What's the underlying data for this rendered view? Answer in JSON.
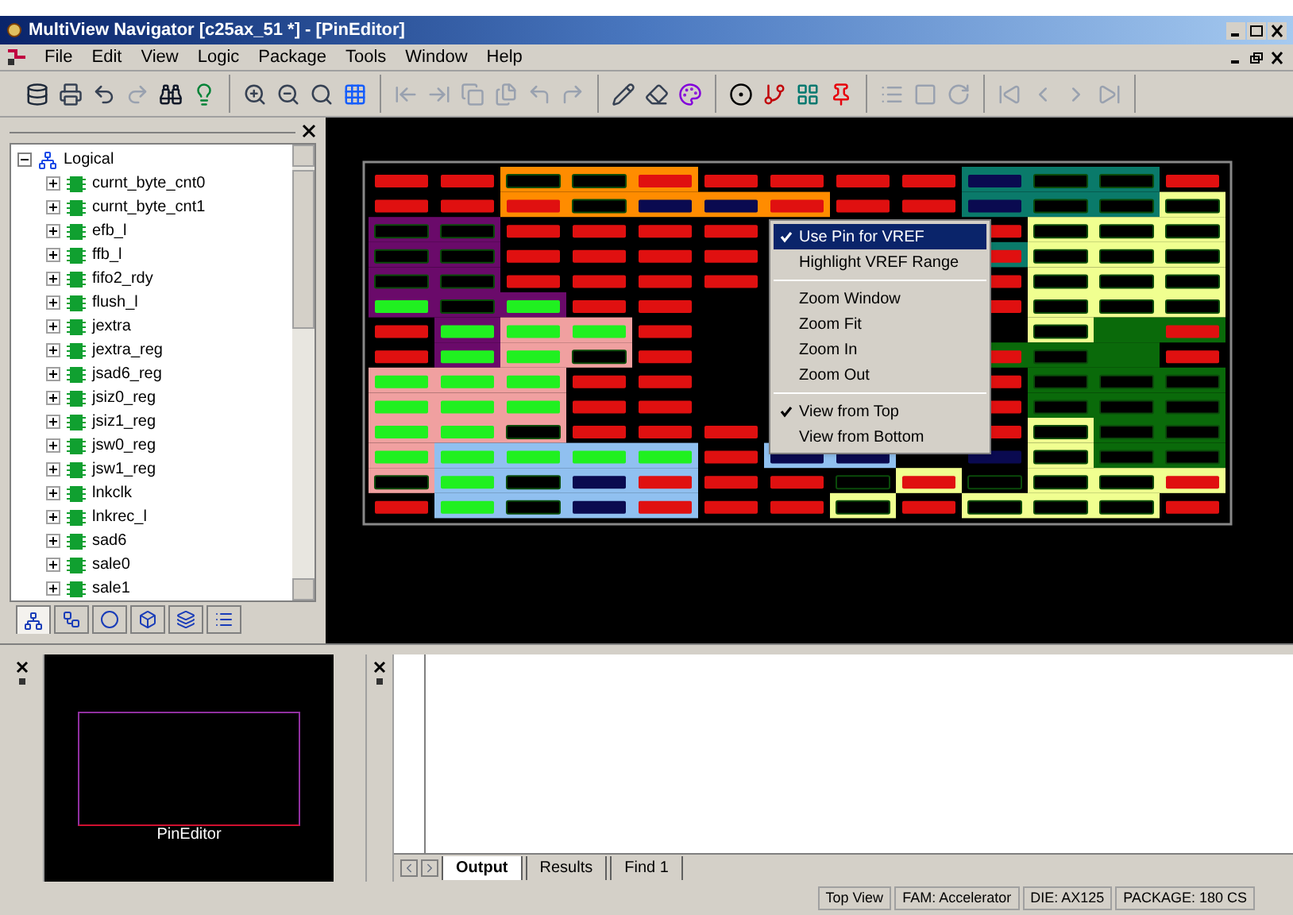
{
  "window": {
    "title": "MultiView Navigator [c25ax_51 *] - [PinEditor]"
  },
  "menu": [
    "File",
    "Edit",
    "View",
    "Logic",
    "Package",
    "Tools",
    "Window",
    "Help"
  ],
  "tree": {
    "label": "Logical",
    "expanded": true,
    "children": [
      {
        "label": "curnt_byte_cnt0",
        "expanded": false
      },
      {
        "label": "curnt_byte_cnt1",
        "expanded": false
      },
      {
        "label": "efb_l",
        "expanded": false
      },
      {
        "label": "ffb_l",
        "expanded": false
      },
      {
        "label": "fifo2_rdy",
        "expanded": false
      },
      {
        "label": "flush_l",
        "expanded": false
      },
      {
        "label": "jextra",
        "expanded": false
      },
      {
        "label": "jextra_reg",
        "expanded": false
      },
      {
        "label": "jsad6_reg",
        "expanded": false
      },
      {
        "label": "jsiz0_reg",
        "expanded": false
      },
      {
        "label": "jsiz1_reg",
        "expanded": false
      },
      {
        "label": "jsw0_reg",
        "expanded": false
      },
      {
        "label": "jsw1_reg",
        "expanded": false
      },
      {
        "label": "lnkclk",
        "expanded": false
      },
      {
        "label": "lnkrec_l",
        "expanded": false
      },
      {
        "label": "sad6",
        "expanded": false
      },
      {
        "label": "sale0",
        "expanded": false
      },
      {
        "label": "sale1",
        "expanded": false
      }
    ]
  },
  "panel_tabs": [
    {
      "selected": true
    },
    {
      "selected": false
    },
    {
      "selected": false
    },
    {
      "selected": false
    },
    {
      "selected": false
    },
    {
      "selected": false
    }
  ],
  "context_menu": [
    {
      "kind": "item",
      "label": "Use Pin for VREF",
      "checked": true,
      "selected": true
    },
    {
      "kind": "item",
      "label": "Highlight VREF Range",
      "checked": false,
      "selected": false
    },
    {
      "kind": "separator"
    },
    {
      "kind": "item",
      "label": "Zoom Window",
      "checked": false,
      "selected": false
    },
    {
      "kind": "item",
      "label": "Zoom Fit",
      "checked": false,
      "selected": false
    },
    {
      "kind": "item",
      "label": "Zoom In",
      "checked": false,
      "selected": false
    },
    {
      "kind": "item",
      "label": "Zoom Out",
      "checked": false,
      "selected": false
    },
    {
      "kind": "separator"
    },
    {
      "kind": "item",
      "label": "View from Top",
      "checked": true,
      "selected": false
    },
    {
      "kind": "item",
      "label": "View from Bottom",
      "checked": false,
      "selected": false
    }
  ],
  "overview": {
    "label": "PinEditor"
  },
  "output_tabs": [
    {
      "label": "Output",
      "selected": true
    },
    {
      "label": "Results",
      "selected": false
    },
    {
      "label": "Find 1",
      "selected": false
    }
  ],
  "status_bar": [
    "Top View",
    "FAM: Accelerator",
    "DIE: AX125",
    "PACKAGE: 180 CS"
  ]
}
